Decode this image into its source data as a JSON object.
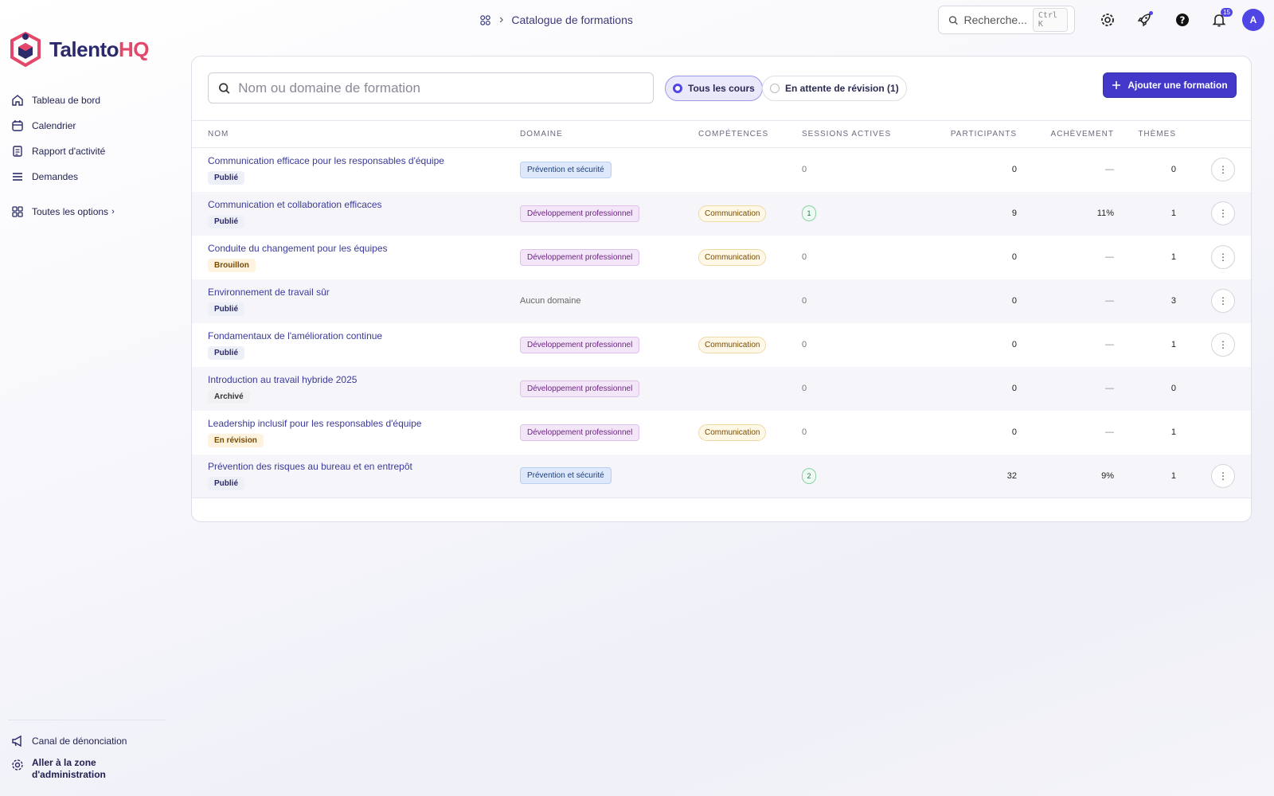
{
  "app": {
    "logo_a": "Talento",
    "logo_b": "HQ"
  },
  "sidebar": {
    "items": [
      {
        "label": "Tableau de bord"
      },
      {
        "label": "Calendrier"
      },
      {
        "label": "Rapport d'activité"
      },
      {
        "label": "Demandes"
      }
    ],
    "all_options": "Toutes les options",
    "bottom": [
      {
        "label": "Canal de dénonciation"
      },
      {
        "label": "Aller à la zone d'administration"
      }
    ]
  },
  "header": {
    "breadcrumb": "Catalogue de formations",
    "search_label": "Recherche...",
    "search_shortcut": "Ctrl K",
    "notifications_count": "15",
    "avatar_initial": "A"
  },
  "filters": {
    "search_placeholder": "Nom ou domaine de formation",
    "tab_all": "Tous les cours",
    "tab_pending": "En attente de révision (1)",
    "add_label": "Ajouter une formation"
  },
  "table": {
    "columns": [
      "NOM",
      "DOMAINE",
      "COMPÉTENCES",
      "SESSIONS ACTIVES",
      "PARTICIPANTS",
      "ACHÈVEMENT",
      "THÈMES"
    ],
    "rows": [
      {
        "name": "Communication efficace pour les responsables d'équipe",
        "status": "Publié",
        "domain": "Prévention et sécurité",
        "skill": "",
        "sessions": "0",
        "participants": "0",
        "completion": "—",
        "themes": "0",
        "actions": true
      },
      {
        "name": "Communication et collaboration efficaces",
        "status": "Publié",
        "domain": "Développement professionnel",
        "skill": "Communication",
        "sessions": "1",
        "participants": "9",
        "completion": "11%",
        "themes": "1",
        "actions": true
      },
      {
        "name": "Conduite du changement pour les équipes",
        "status": "Brouillon",
        "domain": "Développement professionnel",
        "skill": "Communication",
        "sessions": "0",
        "participants": "0",
        "completion": "—",
        "themes": "1",
        "actions": true
      },
      {
        "name": "Environnement de travail sûr",
        "status": "Publié",
        "domain": "Aucun domaine",
        "skill": "",
        "sessions": "0",
        "participants": "0",
        "completion": "—",
        "themes": "3",
        "actions": true
      },
      {
        "name": "Fondamentaux de l'amélioration continue",
        "status": "Publié",
        "domain": "Développement professionnel",
        "skill": "Communication",
        "sessions": "0",
        "participants": "0",
        "completion": "—",
        "themes": "1",
        "actions": true
      },
      {
        "name": "Introduction au travail hybride 2025",
        "status": "Archivé",
        "domain": "Développement professionnel",
        "skill": "",
        "sessions": "0",
        "participants": "0",
        "completion": "—",
        "themes": "0",
        "actions": false
      },
      {
        "name": "Leadership inclusif pour les responsables d'équipe",
        "status": "En révision",
        "domain": "Développement professionnel",
        "skill": "Communication",
        "sessions": "0",
        "participants": "0",
        "completion": "—",
        "themes": "1",
        "actions": false
      },
      {
        "name": "Prévention des risques au bureau et en entrepôt",
        "status": "Publié",
        "domain": "Prévention et sécurité",
        "skill": "",
        "sessions": "2",
        "participants": "32",
        "completion": "9%",
        "themes": "1",
        "actions": true
      }
    ]
  },
  "icons": {
    "home": "home-icon",
    "calendar": "calendar-icon",
    "report": "report-icon",
    "requests": "list-icon",
    "grid": "grid-icon",
    "megaphone": "megaphone-icon",
    "gear": "gear-icon",
    "rocket": "rocket-icon",
    "help": "help-icon",
    "bell": "bell-icon",
    "search": "search-icon",
    "plus": "plus-icon"
  },
  "colors": {
    "accent": "#4338ca",
    "brand_red": "#e5476b",
    "brand_navy": "#2b2a6b"
  }
}
